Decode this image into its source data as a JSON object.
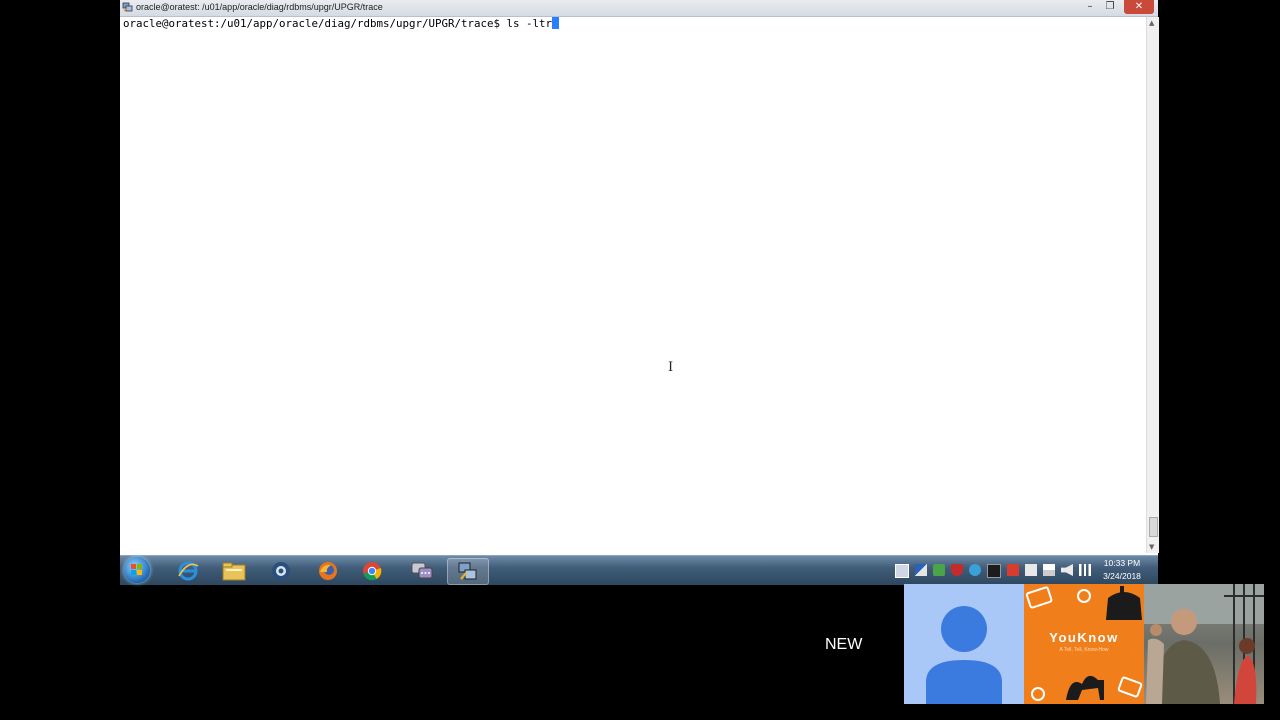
{
  "window": {
    "title": "oracle@oratest: /u01/app/oracle/diag/rdbms/upgr/UPGR/trace",
    "minimize_label": "–",
    "maximize_label": "❐",
    "close_label": "✕"
  },
  "terminal": {
    "prompt": "oracle@oratest:/u01/app/oracle/diag/rdbms/upgr/UPGR/trace$ ",
    "command": "ls -ltr"
  },
  "taskbar": {
    "pinned": [
      {
        "name": "internet-explorer-icon"
      },
      {
        "name": "file-explorer-icon"
      },
      {
        "name": "oracle-icon"
      },
      {
        "name": "firefox-icon"
      },
      {
        "name": "chrome-icon"
      },
      {
        "name": "chat-icon"
      },
      {
        "name": "putty-icon",
        "active": true
      }
    ],
    "clock_time": "10:33 PM",
    "clock_date": "3/24/2018"
  },
  "overlay": {
    "new_label": "NEW",
    "youknow_title": "YouKnow",
    "youknow_subtitle": "A Tell, Tell, Know-How"
  },
  "colors": {
    "terminal_bg": "#ffffff",
    "cursor": "#2a7fff",
    "taskbar": "#415d79",
    "youknow_orange": "#f07f1b",
    "avatar_blue": "#3b7be0"
  }
}
